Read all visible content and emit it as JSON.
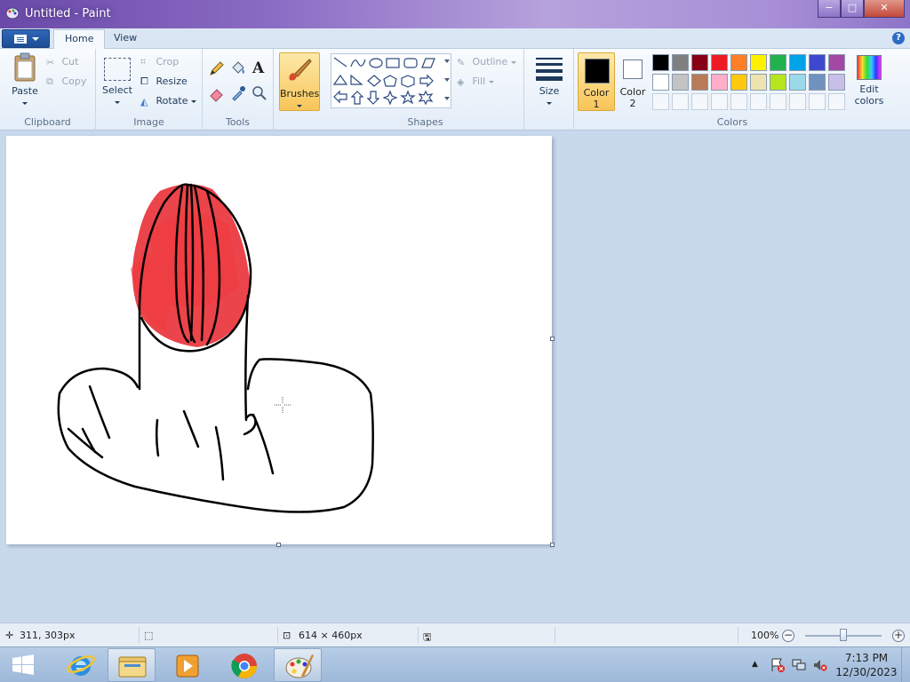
{
  "window": {
    "title": "Untitled - Paint",
    "minimize": "−",
    "maximize": "□",
    "close": "✕"
  },
  "tabs": [
    {
      "label": "Home",
      "active": true
    },
    {
      "label": "View",
      "active": false
    }
  ],
  "ribbon": {
    "clipboard": {
      "label": "Clipboard",
      "paste": "Paste",
      "cut": "Cut",
      "copy": "Copy"
    },
    "image": {
      "label": "Image",
      "select": "Select",
      "crop": "Crop",
      "resize": "Resize",
      "rotate": "Rotate"
    },
    "tools": {
      "label": "Tools"
    },
    "brushes": {
      "label": "Brushes"
    },
    "shapes": {
      "label": "Shapes",
      "outline": "Outline",
      "fill": "Fill"
    },
    "size": {
      "label": "Size"
    },
    "colors": {
      "label": "Colors",
      "color1_label": "Color",
      "color1_num": "1",
      "color2_label": "Color",
      "color2_num": "2",
      "edit_colors_line1": "Edit",
      "edit_colors_line2": "colors",
      "color1_value": "#000000",
      "color2_value": "#ffffff",
      "palette_row1": [
        "#000000",
        "#7f7f7f",
        "#880015",
        "#ed1c24",
        "#ff7f27",
        "#fff200",
        "#22b14c",
        "#00a2e8",
        "#3f48cc",
        "#a349a4"
      ],
      "palette_row2": [
        "#ffffff",
        "#c3c3c3",
        "#b97a57",
        "#ffaec9",
        "#ffc90e",
        "#efe4b0",
        "#b5e61d",
        "#99d9ea",
        "#7092be",
        "#c8bfe7"
      ]
    }
  },
  "statusbar": {
    "cursor_pos": "311, 303px",
    "canvas_size": "614 × 460px",
    "zoom": "100%"
  },
  "taskbar": {
    "time": "7:13 PM",
    "date": "12/30/2023"
  }
}
